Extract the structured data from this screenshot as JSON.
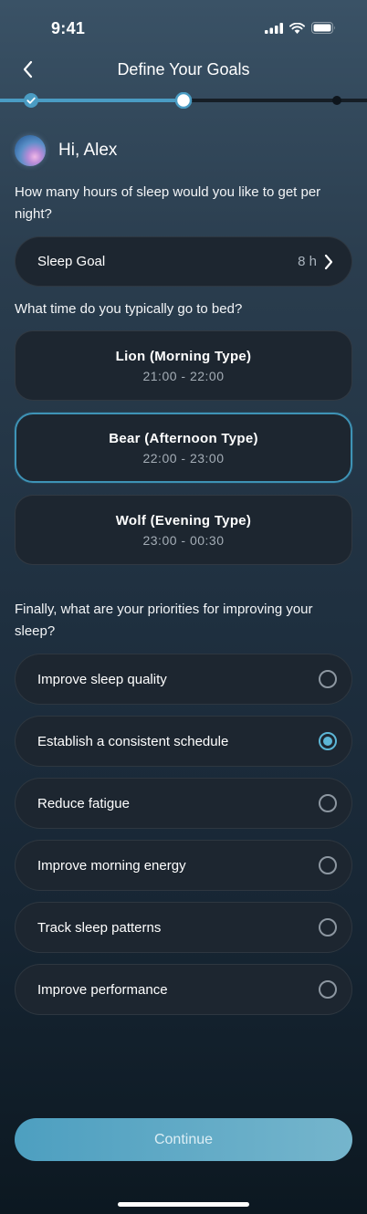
{
  "status_bar": {
    "time": "9:41"
  },
  "header": {
    "title": "Define Your Goals"
  },
  "greeting": {
    "text": "Hi, Alex"
  },
  "sleep_hours": {
    "question": "How many hours of sleep would you like to get per night?",
    "goal_label": "Sleep Goal",
    "goal_value": "8 h"
  },
  "bedtime": {
    "question": "What time do you typically go to bed?",
    "options": [
      {
        "title": "Lion (Morning Type)",
        "time": "21:00 - 22:00",
        "selected": false
      },
      {
        "title": "Bear (Afternoon Type)",
        "time": "22:00 - 23:00",
        "selected": true
      },
      {
        "title": "Wolf (Evening Type)",
        "time": "23:00 - 00:30",
        "selected": false
      }
    ]
  },
  "priorities": {
    "question": "Finally, what are your priorities for improving your sleep?",
    "options": [
      {
        "label": "Improve sleep quality",
        "selected": false
      },
      {
        "label": "Establish a consistent schedule",
        "selected": true
      },
      {
        "label": "Reduce fatigue",
        "selected": false
      },
      {
        "label": "Improve morning energy",
        "selected": false
      },
      {
        "label": "Track sleep patterns",
        "selected": false
      },
      {
        "label": "Improve performance",
        "selected": false
      }
    ]
  },
  "continue_label": "Continue",
  "progress": {
    "steps": 3,
    "current_step": 2
  },
  "colors": {
    "accent": "#3e93b6",
    "radio_selected": "#5cb6d6",
    "card_bg": "#1d2630",
    "button_start": "#4d9fc0",
    "button_end": "#75b5cc"
  },
  "icons": {
    "back": "chevron-left-icon",
    "goal_arrow": "chevron-right-icon",
    "step_done": "check-icon",
    "signal": "cellular-signal-icon",
    "wifi": "wifi-icon",
    "battery": "battery-icon"
  }
}
